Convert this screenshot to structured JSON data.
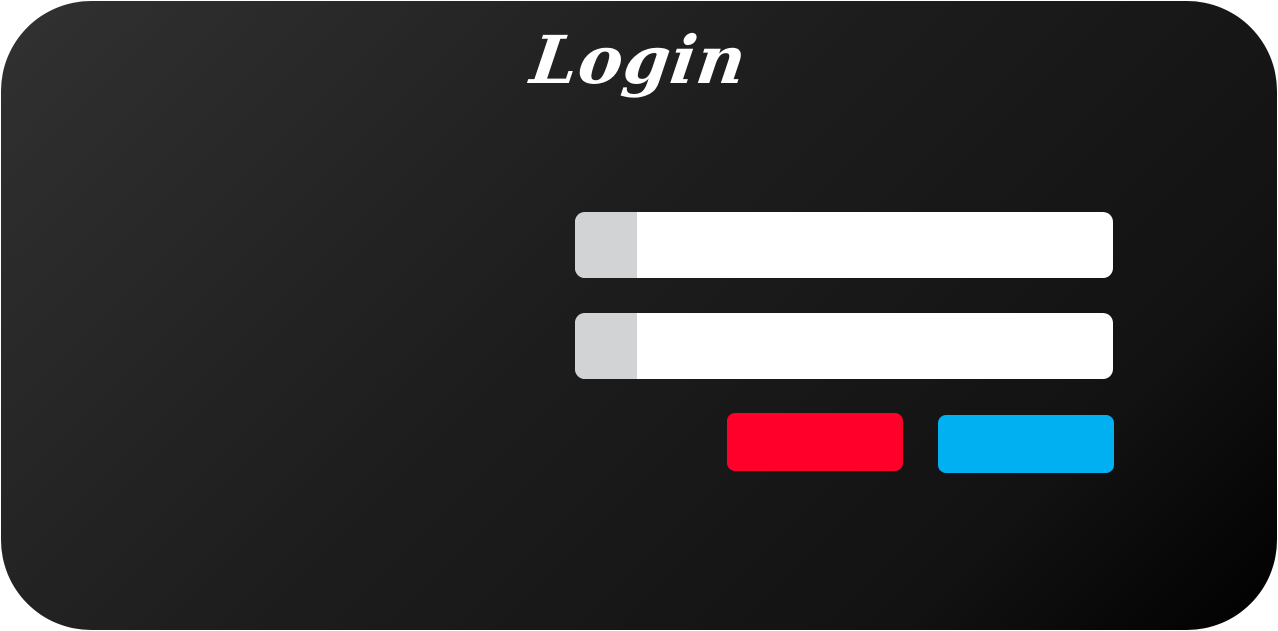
{
  "title": "Login",
  "fields": {
    "username": {
      "value": "",
      "placeholder": ""
    },
    "password": {
      "value": "",
      "placeholder": ""
    }
  },
  "buttons": {
    "cancel_label": "",
    "submit_label": ""
  },
  "colors": {
    "panel_background": "#1d1d1d",
    "field_background": "#ffffff",
    "field_icon_area": "#d1d3d4",
    "cancel_button": "#ff002b",
    "submit_button": "#00b0f0"
  }
}
